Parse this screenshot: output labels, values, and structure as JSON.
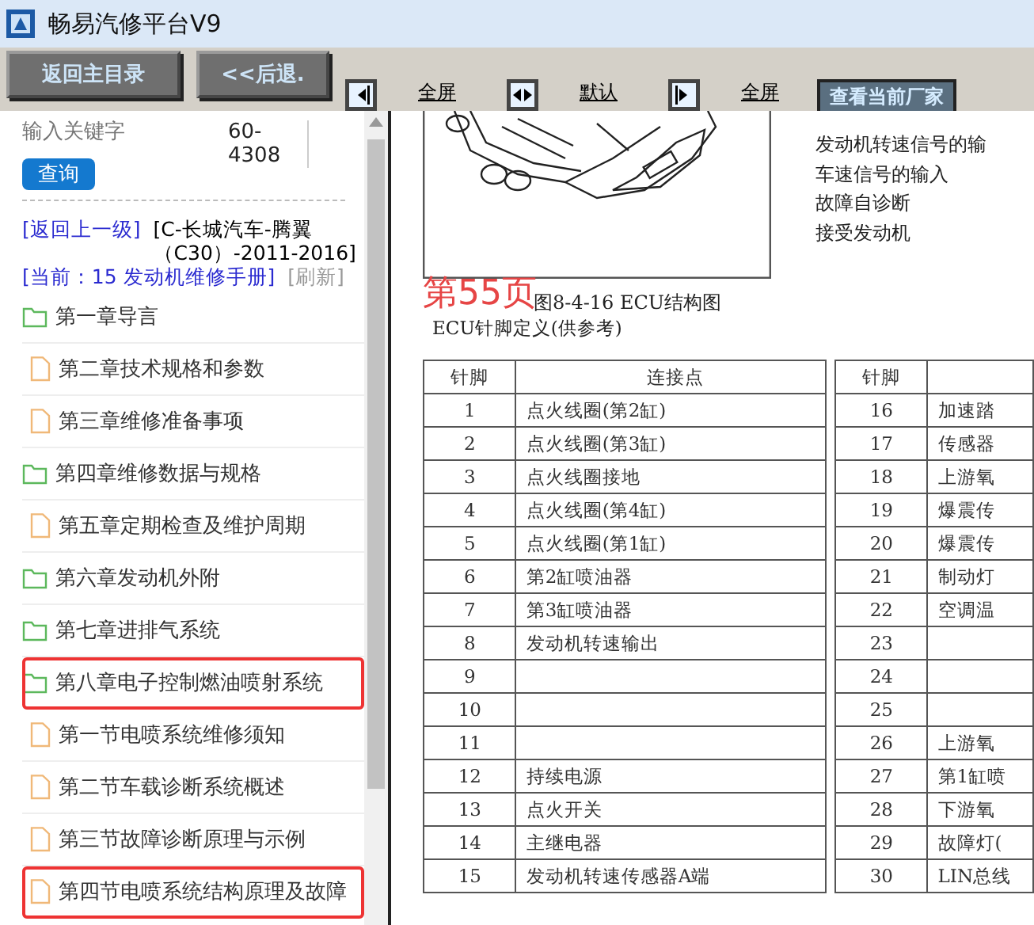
{
  "window": {
    "title": "畅易汽修平台V9"
  },
  "toolbar": {
    "buttons": [
      "返回主目录",
      "<<后退."
    ],
    "view_buttons": [
      {
        "kind": "right",
        "label": "全屏"
      },
      {
        "kind": "both",
        "label": "默认"
      },
      {
        "kind": "left",
        "label": "全屏"
      }
    ],
    "vendor_button": "查看当前厂家"
  },
  "sidebar": {
    "search": {
      "placeholder": "输入关键字",
      "value": "60-4308",
      "button": "查询"
    },
    "breadcrumb": {
      "back_link": "[返回上一级]",
      "path": "[C-长城汽车-腾翼（C30）-2011-2016]",
      "current": "[当前：15 发动机维修手册]",
      "refresh": "[刷新]"
    },
    "items": [
      {
        "kind": "folder",
        "label": "第一章导言",
        "highlighted": false
      },
      {
        "kind": "file",
        "label": "第二章技术规格和参数",
        "highlighted": false
      },
      {
        "kind": "file",
        "label": "第三章维修准备事项",
        "highlighted": false
      },
      {
        "kind": "folder",
        "label": "第四章维修数据与规格",
        "highlighted": false
      },
      {
        "kind": "file",
        "label": "第五章定期检查及维护周期",
        "highlighted": false
      },
      {
        "kind": "folder",
        "label": "第六章发动机外附",
        "highlighted": false
      },
      {
        "kind": "folder",
        "label": "第七章进排气系统",
        "highlighted": false
      },
      {
        "kind": "folder",
        "label": "第八章电子控制燃油喷射系统",
        "highlighted": true
      },
      {
        "kind": "file",
        "label": "第一节电喷系统维修须知",
        "highlighted": false
      },
      {
        "kind": "file",
        "label": "第二节车载诊断系统概述",
        "highlighted": false
      },
      {
        "kind": "file",
        "label": "第三节故障诊断原理与示例",
        "highlighted": false
      },
      {
        "kind": "file",
        "label": "第四节电喷系统结构原理及故障",
        "highlighted": true
      }
    ]
  },
  "document": {
    "side_lines": [
      "发动机转速信号的输",
      "车速信号的输入",
      "故障自诊断",
      "接受发动机"
    ],
    "page_label": "第55页",
    "figure_caption": "图8-4-16 ECU结构图",
    "table_title": "ECU针脚定义(供参考)",
    "table": {
      "columns": [
        "针脚",
        "连接点",
        "针脚"
      ],
      "rows": [
        [
          "1",
          "点火线圈(第2缸)",
          "16",
          "加速踏"
        ],
        [
          "2",
          "点火线圈(第3缸)",
          "17",
          "传感器"
        ],
        [
          "3",
          "点火线圈接地",
          "18",
          "上游氧"
        ],
        [
          "4",
          "点火线圈(第4缸)",
          "19",
          "爆震传"
        ],
        [
          "5",
          "点火线圈(第1缸)",
          "20",
          "爆震传"
        ],
        [
          "6",
          "第2缸喷油器",
          "21",
          "制动灯"
        ],
        [
          "7",
          "第3缸喷油器",
          "22",
          "空调温"
        ],
        [
          "8",
          "发动机转速输出",
          "23",
          ""
        ],
        [
          "9",
          "",
          "24",
          ""
        ],
        [
          "10",
          "",
          "25",
          ""
        ],
        [
          "11",
          "",
          "26",
          "上游氧"
        ],
        [
          "12",
          "持续电源",
          "27",
          "第1缸喷"
        ],
        [
          "13",
          "点火开关",
          "28",
          "下游氧"
        ],
        [
          "14",
          "主继电器",
          "29",
          "故障灯("
        ],
        [
          "15",
          "发动机转速传感器A端",
          "30",
          "LIN总线"
        ]
      ]
    }
  }
}
